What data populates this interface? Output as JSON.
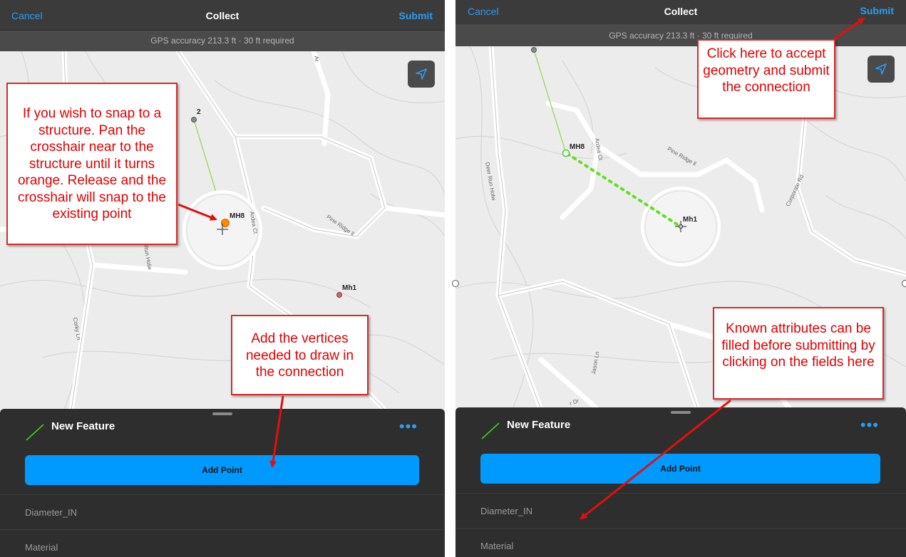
{
  "left": {
    "header": {
      "cancel": "Cancel",
      "title": "Collect",
      "submit": "Submit"
    },
    "gps_text": "GPS accuracy 213.3 ft  ·  30 ft required",
    "map": {
      "vertex_label": "2",
      "snap_label": "MH8",
      "other_label": "Mh1",
      "streets": {
        "ardea": "Ardea Ct",
        "pine": "Pine Ridge ll",
        "deer": "Run Holw",
        "corky": "Corky Ln",
        "ar": "Ar"
      }
    },
    "sheet": {
      "feature_name": "New Feature",
      "more": "•••",
      "add_point": "Add Point",
      "fields": [
        "Diameter_IN",
        "Material"
      ]
    },
    "callouts": {
      "snap": "If you wish to snap to a structure.  Pan the crosshair near to the structure until it turns orange.  Release and the crosshair will snap to the existing point",
      "vertices": "Add the vertices needed to draw in the connection"
    }
  },
  "right": {
    "header": {
      "cancel": "Cancel",
      "title": "Collect",
      "submit": "Submit"
    },
    "gps_text": "GPS accuracy 213.3 ft  ·  30 ft required",
    "map": {
      "start_label": "MH8",
      "end_label": "Mh1",
      "streets": {
        "ardea": "Ardea Ct",
        "pine": "Pine Ridge ll",
        "deer": "Deer Run Holw",
        "corporate": "Corporate Rd",
        "jason": "Jason Ln",
        "r": "r Dr"
      }
    },
    "sheet": {
      "feature_name": "New Feature",
      "more": "•••",
      "add_point": "Add Point",
      "fields": [
        "Diameter_IN",
        "Material"
      ]
    },
    "callouts": {
      "submit": "Click here to accept geometry and submit the connection",
      "attributes": "Known attributes can be filled before submitting by clicking on the fields here"
    }
  },
  "colors": {
    "accent": "#2b9cf2",
    "button": "#009aff",
    "callout_text": "#e00000",
    "arrow": "#e01010",
    "line": "#66dd22",
    "snap_point": "#ff8800",
    "structure_point": "#d0646e"
  },
  "icons": [
    "navigation-arrow-icon",
    "line-feature-icon",
    "more-icon",
    "crosshair-icon"
  ]
}
